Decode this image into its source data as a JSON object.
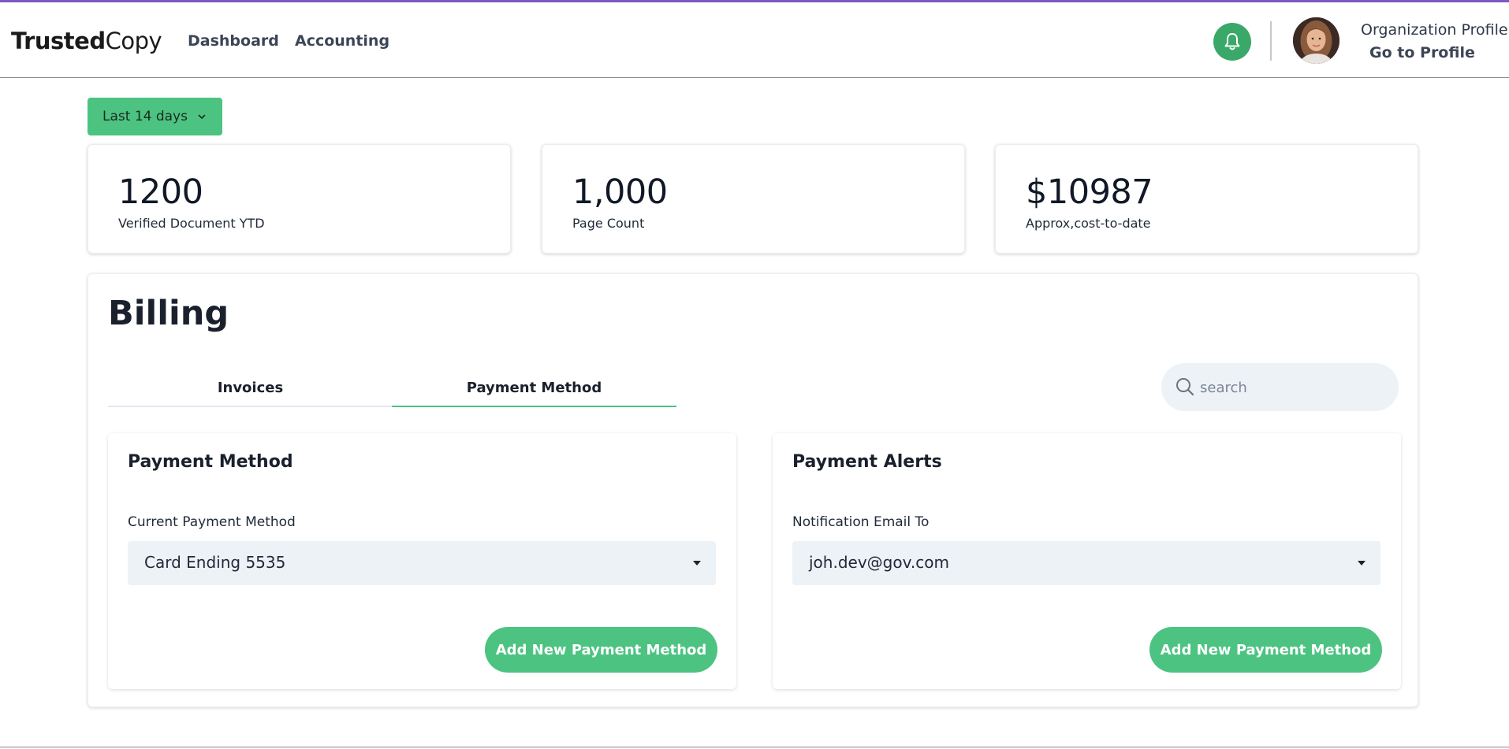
{
  "brand": {
    "bold": "Trusted",
    "light": "Copy"
  },
  "nav": {
    "dashboard": "Dashboard",
    "accounting": "Accounting"
  },
  "profile": {
    "org_label": "Organization Profile",
    "goto_label": "Go to Profile"
  },
  "filters": {
    "range_label": "Last 14 days"
  },
  "stats": [
    {
      "value": "1200",
      "label": "Verified Document YTD"
    },
    {
      "value": "1,000",
      "label": "Page Count"
    },
    {
      "value": "$10987",
      "label": "Approx,cost-to-date"
    }
  ],
  "billing": {
    "title": "Billing",
    "tabs": [
      {
        "label": "Invoices",
        "active": false
      },
      {
        "label": "Payment Method",
        "active": true
      }
    ],
    "search": {
      "placeholder": "search",
      "value": ""
    },
    "payment_method": {
      "title": "Payment Method",
      "field_label": "Current Payment Method",
      "selected": "Card Ending 5535",
      "button_label": "Add New Payment Method"
    },
    "payment_alerts": {
      "title": "Payment Alerts",
      "field_label": "Notification Email To",
      "selected": "joh.dev@gov.com",
      "button_label": "Add New Payment Method"
    }
  },
  "colors": {
    "accent": "#4cc381",
    "bell": "#3aa869",
    "top_bar": "#7e57c2"
  },
  "icons": {
    "notification": "bell-icon",
    "search": "search-icon",
    "dropdown": "chevron-down-icon"
  }
}
